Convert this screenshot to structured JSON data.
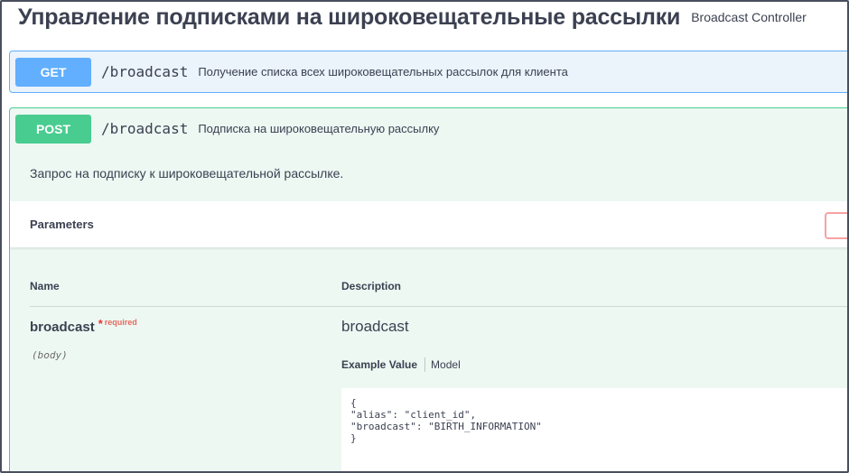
{
  "section": {
    "title": "Управление подписками на широковещательные рассылки",
    "subtitle": "Broadcast Controller"
  },
  "operations": [
    {
      "method": "GET",
      "path": "/broadcast",
      "summary": "Получение списка всех широковещательных рассылок для клиента",
      "color": "#61affe"
    },
    {
      "method": "POST",
      "path": "/broadcast",
      "summary": "Подписка на широковещательную рассылку",
      "color": "#49cc90",
      "description": "Запрос на подписку к широковещательной рассылке.",
      "parameters_title": "Parameters",
      "columns": {
        "name": "Name",
        "description": "Description"
      },
      "param": {
        "name": "broadcast",
        "required_mark": "*",
        "required_text": "required",
        "in": "(body)",
        "description": "broadcast",
        "tabs": {
          "example": "Example Value",
          "model": "Model"
        },
        "example_json": "{\n\"alias\": \"client_id\",\n\"broadcast\": \"BIRTH_INFORMATION\"\n}"
      }
    }
  ]
}
